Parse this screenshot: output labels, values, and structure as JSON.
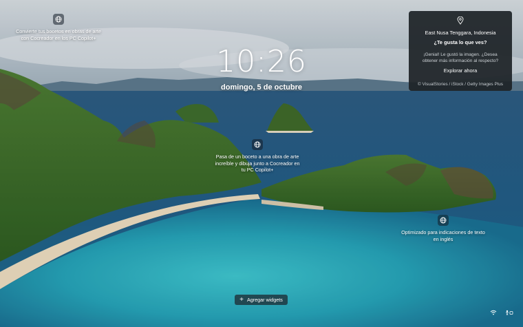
{
  "lockscreen": {
    "time": "10:26",
    "date": "domingo, 5 de octubre"
  },
  "hotspots": [
    {
      "text": "Convierte tus bocetos en obras de arte con Cocreador en los PC Copilot+"
    },
    {
      "text": "Pasa de un boceto a una obra de arte increíble y dibuja junto a Cocreador en tu PC Copilot+"
    },
    {
      "text": "Optimizado para indicaciones de texto en inglés"
    }
  ],
  "spotlight": {
    "location": "East Nusa Tenggara, Indonesia",
    "question": "¿Te gusta lo que ves?",
    "body": "¡Genial! Le gustó la imagen. ¿Desea obtener más información al respecto?",
    "button": "Explorar ahora",
    "credit": "© VisualStories / iStock / Getty Images Plus"
  },
  "widgets": {
    "label": "Agregar widgets",
    "icon": "plus-icon"
  },
  "tray": {
    "wifi_icon": "wifi-icon",
    "accessibility_icon": "accessibility-icon"
  },
  "colors": {
    "sea_deep": "#1f5f8a",
    "lagoon": "#2bb3c0",
    "hills": "#3f7a2c",
    "sand": "#e9d9bf",
    "panel": "#1c2226"
  }
}
